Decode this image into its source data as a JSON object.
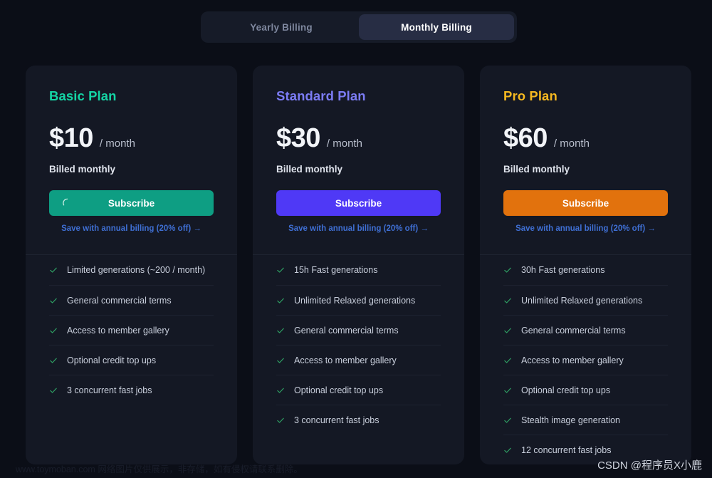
{
  "billing_toggle": {
    "yearly_label": "Yearly Billing",
    "monthly_label": "Monthly Billing",
    "active": "Monthly Billing"
  },
  "plans": [
    {
      "name": "Basic Plan",
      "accent": "#14d4a4",
      "price": "$10",
      "period": "/ month",
      "billed": "Billed monthly",
      "button_label": "Subscribe",
      "button_color": "#0e9e83",
      "loading": true,
      "annual_link": "Save with annual billing (20% off)  →",
      "features": [
        "Limited generations (~200 / month)",
        "General commercial terms",
        "Access to member gallery",
        "Optional credit top ups",
        "3 concurrent fast jobs"
      ]
    },
    {
      "name": "Standard Plan",
      "accent": "#7c7cf5",
      "price": "$30",
      "period": "/ month",
      "billed": "Billed monthly",
      "button_label": "Subscribe",
      "button_color": "#4f39f6",
      "loading": false,
      "annual_link": "Save with annual billing (20% off)  →",
      "features": [
        "15h Fast generations",
        "Unlimited Relaxed generations",
        "General commercial terms",
        "Access to member gallery",
        "Optional credit top ups",
        "3 concurrent fast jobs"
      ]
    },
    {
      "name": "Pro Plan",
      "accent": "#f5b820",
      "price": "$60",
      "period": "/ month",
      "billed": "Billed monthly",
      "button_label": "Subscribe",
      "button_color": "#e2720d",
      "loading": false,
      "annual_link": "Save with annual billing (20% off)  →",
      "features": [
        "30h Fast generations",
        "Unlimited Relaxed generations",
        "General commercial terms",
        "Access to member gallery",
        "Optional credit top ups",
        "Stealth image generation",
        "12 concurrent fast jobs"
      ]
    }
  ],
  "watermarks": {
    "left": "www.toymoban.com 网络图片仅供展示，非存储，如有侵权请联系删除。",
    "right": "CSDN @程序员X小鹿"
  },
  "colors": {
    "page_bg": "#0b0e17",
    "card_bg": "#141824",
    "toggle_bg": "#161b28",
    "toggle_active_bg": "#272d44",
    "check_green": "#2e9e63",
    "link_blue": "#3f6fd4"
  }
}
